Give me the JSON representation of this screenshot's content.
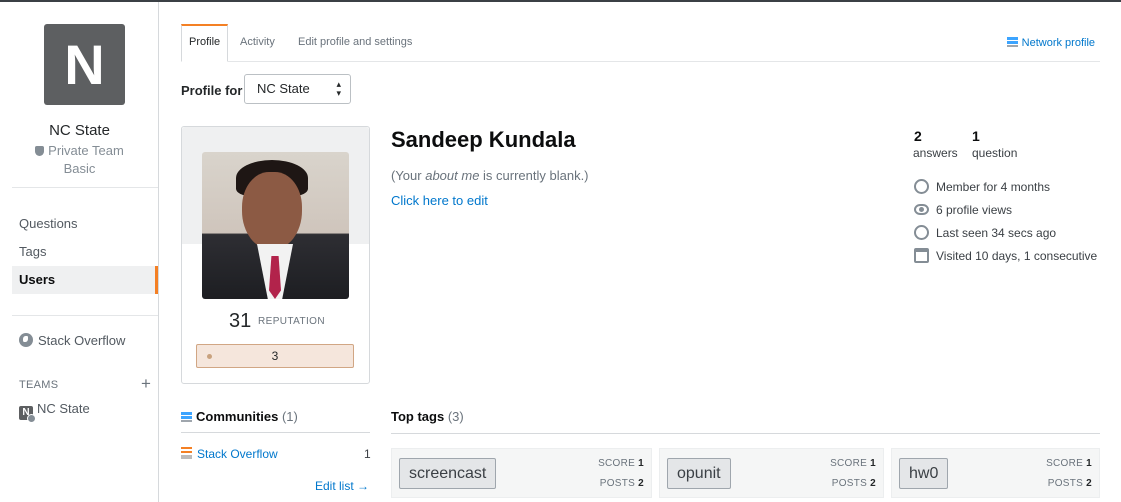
{
  "team": {
    "initial": "N",
    "name": "NC State",
    "visibility": "Private Team",
    "plan": "Basic"
  },
  "nav": {
    "items": [
      {
        "label": "Questions"
      },
      {
        "label": "Tags"
      },
      {
        "label": "Users",
        "active": true
      }
    ],
    "public_site": "Stack Overflow",
    "teams_label": "TEAMS",
    "add_team_icon": "plus-icon",
    "team_link": "NC State"
  },
  "tabs": [
    {
      "label": "Profile",
      "active": true
    },
    {
      "label": "Activity"
    },
    {
      "label": "Edit profile and settings"
    }
  ],
  "network_profile": "Network profile",
  "profile_for": {
    "label": "Profile for",
    "selected": "NC State"
  },
  "user": {
    "name": "Sandeep Kundala",
    "about_prefix": "(Your ",
    "about_em": "about me",
    "about_suffix": " is currently blank.)",
    "edit_link": "Click here to edit",
    "reputation": "31",
    "reputation_label": "REPUTATION",
    "bronze_badges": "3"
  },
  "stats": {
    "answers_count": "2",
    "answers_label": "answers",
    "questions_count": "1",
    "questions_label": "question",
    "meta": [
      {
        "icon": "history-icon",
        "text": "Member for 4 months"
      },
      {
        "icon": "eye-icon",
        "text": "6 profile views"
      },
      {
        "icon": "clock-icon",
        "text": "Last seen 34 secs ago"
      },
      {
        "icon": "calendar-icon",
        "text": "Visited 10 days, 1 consecutive"
      }
    ]
  },
  "communities": {
    "title": "Communities",
    "count": "(1)",
    "items": [
      {
        "name": "Stack Overflow",
        "reputation": "1"
      }
    ],
    "edit_list": "Edit list →"
  },
  "top_tags": {
    "title": "Top tags",
    "count": "(3)",
    "score_label": "SCORE",
    "posts_label": "POSTS",
    "items": [
      {
        "name": "screencast",
        "score": "1",
        "posts": "2"
      },
      {
        "name": "opunit",
        "score": "1",
        "posts": "2"
      },
      {
        "name": "hw0",
        "score": "1",
        "posts": "2"
      }
    ]
  },
  "colors": {
    "accent": "#f48024",
    "link": "#0077cc",
    "bronze": "#c9a27e"
  }
}
